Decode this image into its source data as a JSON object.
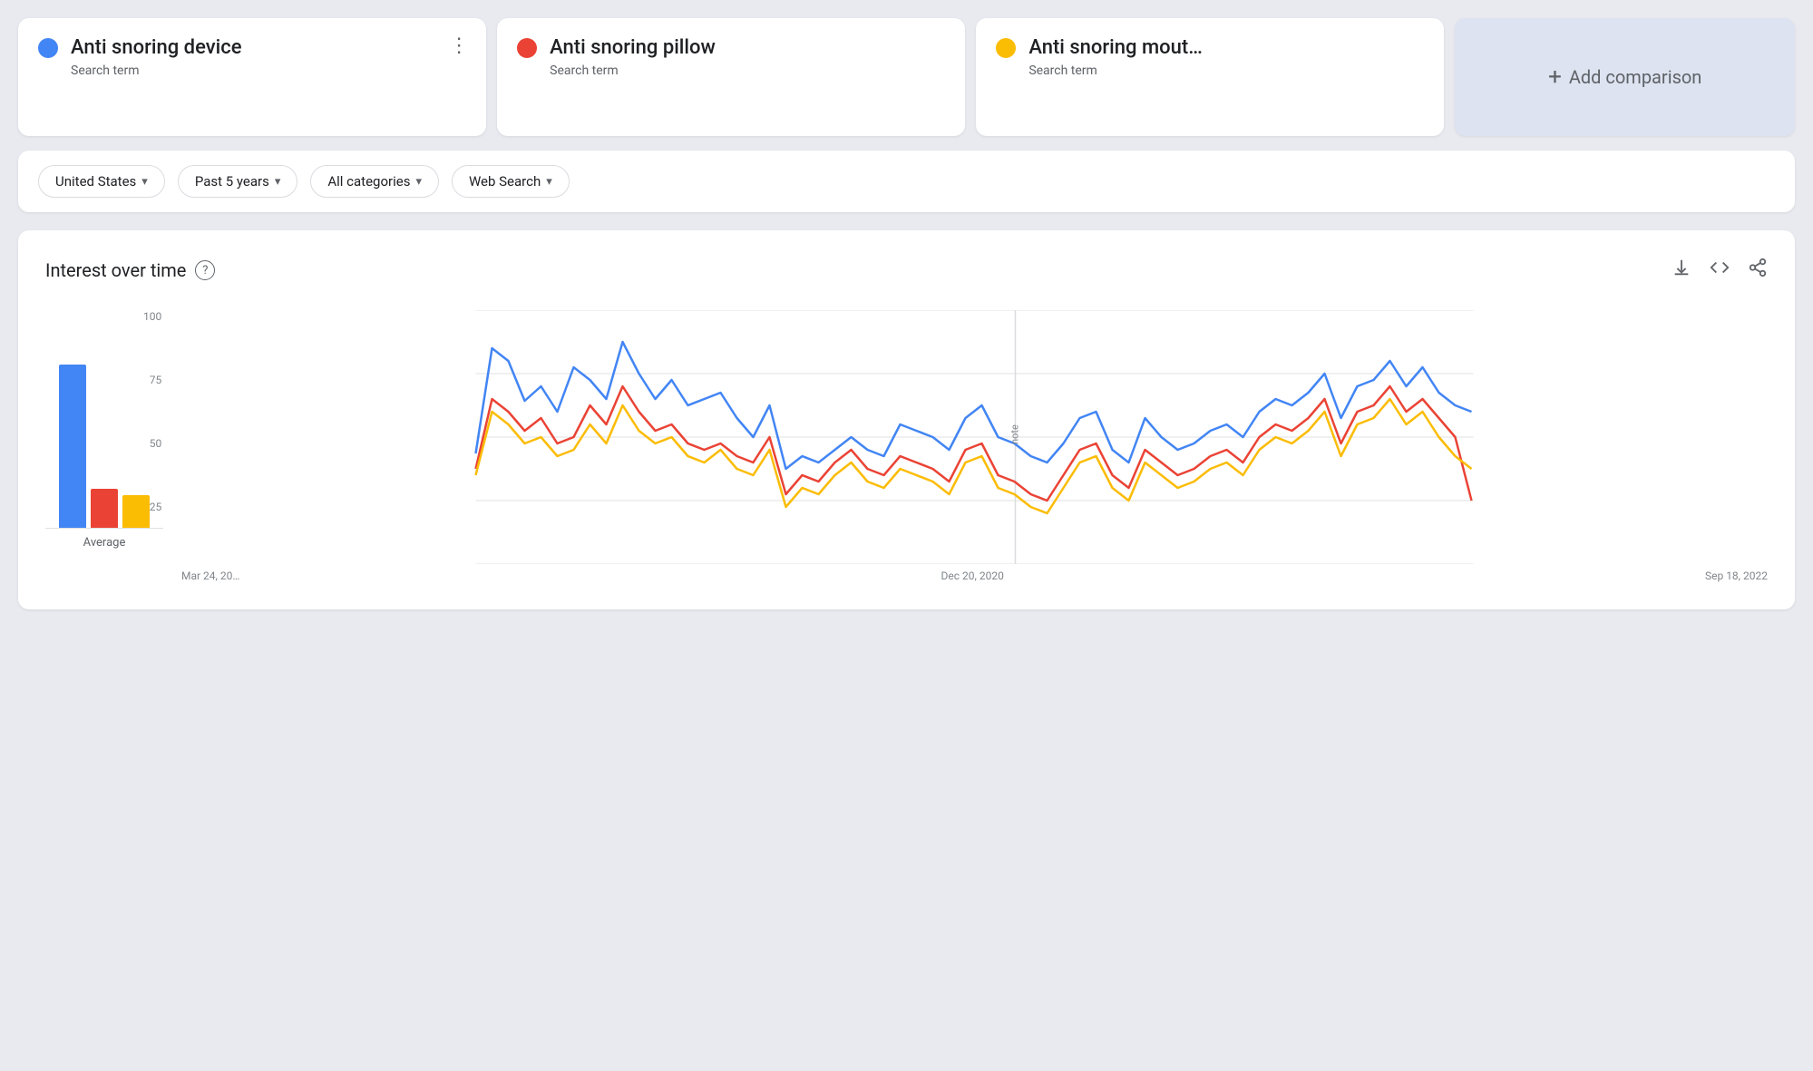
{
  "cards": [
    {
      "id": "card-device",
      "name": "Anti snoring device",
      "type": "Search term",
      "color": "#4285f4",
      "showMenu": true
    },
    {
      "id": "card-pillow",
      "name": "Anti snoring pillow",
      "type": "Search term",
      "color": "#ea4335",
      "showMenu": false
    },
    {
      "id": "card-mouthguard",
      "name": "Anti snoring mout…",
      "type": "Search term",
      "color": "#fbbc04",
      "showMenu": false
    }
  ],
  "add_comparison_label": "Add comparison",
  "filters": [
    {
      "id": "region",
      "label": "United States"
    },
    {
      "id": "time",
      "label": "Past 5 years"
    },
    {
      "id": "category",
      "label": "All categories"
    },
    {
      "id": "search_type",
      "label": "Web Search"
    }
  ],
  "chart": {
    "title": "Interest over time",
    "y_labels": [
      "100",
      "75",
      "50",
      "25",
      ""
    ],
    "x_labels": [
      "Mar 24, 20…",
      "Dec 20, 2020",
      "Sep 18, 2022"
    ],
    "avg_label": "Average",
    "avg_bars": [
      {
        "color": "#4285f4",
        "height_pct": 75
      },
      {
        "color": "#ea4335",
        "height_pct": 20
      },
      {
        "color": "#fbbc04",
        "height_pct": 18
      }
    ]
  },
  "icons": {
    "help": "?",
    "download": "↓",
    "code": "<>",
    "share": "↗",
    "menu_dots": "⋮",
    "add": "+"
  }
}
